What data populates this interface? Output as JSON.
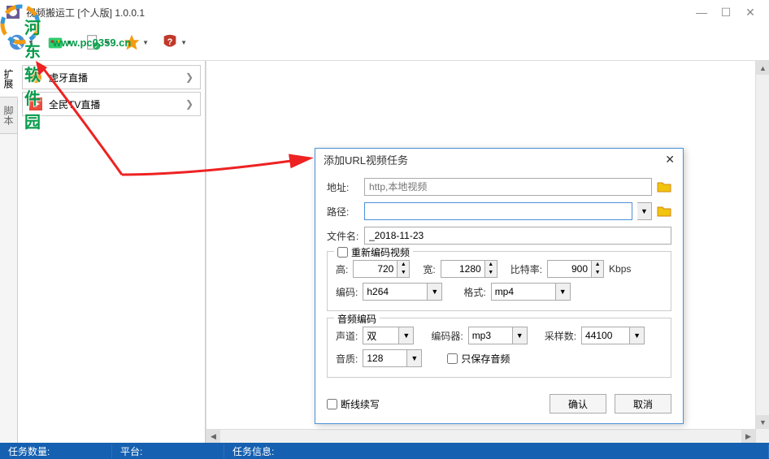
{
  "window": {
    "title": "视频搬运工 [个人版] 1.0.0.1",
    "minimize": "—",
    "maximize": "☐",
    "close": "✕"
  },
  "watermark": {
    "text": "河东软件园",
    "url": "www.pc0359.cn"
  },
  "sidebar": {
    "tabs": [
      "扩展",
      "脚本"
    ],
    "items": [
      {
        "label": "虎牙直播",
        "icon": "huya"
      },
      {
        "label": "全民TV直播",
        "icon": "quanmin"
      }
    ]
  },
  "dialog": {
    "title": "添加URL视频任务",
    "address_label": "地址:",
    "address_placeholder": "http,本地视频",
    "path_label": "路径:",
    "path_value": "",
    "filename_label": "文件名:",
    "filename_value": "_2018-11-23",
    "video_group": {
      "legend": "重新编码视频",
      "height_label": "高:",
      "height_value": "720",
      "width_label": "宽:",
      "width_value": "1280",
      "bitrate_label": "比特率:",
      "bitrate_value": "900",
      "bitrate_unit": "Kbps",
      "codec_label": "编码:",
      "codec_value": "h264",
      "format_label": "格式:",
      "format_value": "mp4"
    },
    "audio_group": {
      "legend": "音频编码",
      "channel_label": "声道:",
      "channel_value": "双",
      "codec_label": "编码器:",
      "codec_value": "mp3",
      "samplerate_label": "采样数:",
      "samplerate_value": "44100",
      "quality_label": "音质:",
      "quality_value": "128",
      "audio_only": "只保存音频"
    },
    "resume_label": "断线续写",
    "ok": "确认",
    "cancel": "取消"
  },
  "status": {
    "tasks": "任务数量:",
    "platform": "平台:",
    "info": "任务信息:"
  }
}
